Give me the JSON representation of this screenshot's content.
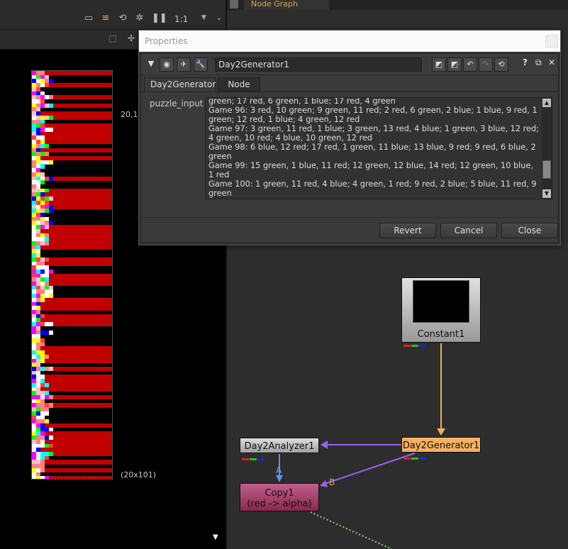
{
  "viewer": {
    "zoom": "1:1",
    "coord_top": "20,1",
    "coord_bottom": "(20x101)"
  },
  "graph": {
    "tab_label": "Node Graph",
    "nodes": {
      "constant": "Constant1",
      "generator": "Day2Generator1",
      "analyzer": "Day2Analyzer1",
      "copy_line1": "Copy1",
      "copy_line2": "(red -> alpha)"
    },
    "edge_labels": {
      "a": "A",
      "b": "B"
    }
  },
  "dialog": {
    "title": "Properties",
    "node_name": "Day2Generator1",
    "help": "?",
    "tabs": [
      {
        "label": "Day2Generator"
      },
      {
        "label": "Node"
      }
    ],
    "field_label": "puzzle_input",
    "puzzle_input": "green; 17 red, 6 green, 1 blue; 17 red, 4 green\nGame 96: 3 red, 10 green; 9 green, 11 red; 2 red, 6 green, 2 blue; 1 blue, 9 red, 1 green; 12 red, 1 blue; 4 green, 12 red\nGame 97: 3 green, 11 red, 1 blue; 3 green, 13 red, 4 blue; 1 green, 3 blue, 12 red; 4 green, 10 red; 4 blue, 10 green, 12 red\nGame 98: 6 blue, 12 red; 17 red, 1 green, 11 blue; 13 blue, 9 red; 9 red, 6 blue, 2 green\nGame 99: 15 green, 1 blue, 11 red; 12 green, 12 blue, 14 red; 12 green, 10 blue, 1 red\nGame 100: 1 green, 11 red, 4 blue; 4 green, 1 red; 9 red, 2 blue; 5 blue, 11 red, 9 green",
    "buttons": {
      "revert": "Revert",
      "cancel": "Cancel",
      "close": "Close"
    }
  },
  "colors": {
    "accent_orange": "#e8a040",
    "generator_node": "#f5b060",
    "copy_node": "#b04a78",
    "edge_orange": "#f0b060",
    "edge_purple": "#9a60f0",
    "edge_blue": "#6090f0"
  }
}
